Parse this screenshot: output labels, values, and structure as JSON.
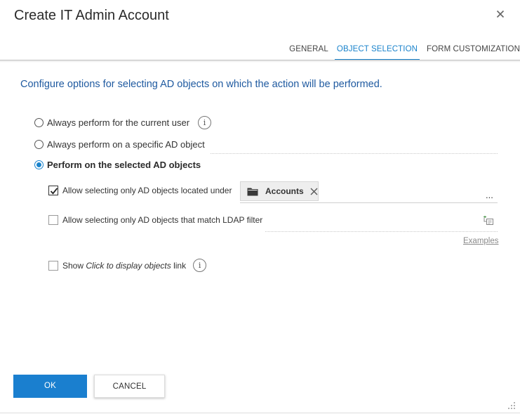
{
  "dialog": {
    "title": "Create IT Admin Account",
    "close_icon": "close-icon"
  },
  "tabs": [
    {
      "label": "GENERAL",
      "active": false
    },
    {
      "label": "OBJECT SELECTION",
      "active": true
    },
    {
      "label": "FORM CUSTOMIZATION",
      "active": false
    }
  ],
  "intro": "Configure options for selecting AD objects on which the action will be performed.",
  "radios": [
    {
      "label": "Always perform for the current user",
      "checked": false,
      "info_icon": "info-icon"
    },
    {
      "label": "Always perform on a specific AD object",
      "checked": false
    },
    {
      "label": "Perform on the selected AD objects",
      "checked": true
    }
  ],
  "options": {
    "located_under": {
      "label": "Allow selecting only AD objects located under",
      "checked": true,
      "chip_label": "Accounts",
      "chip_icon": "folder-icon",
      "browse_label": "..."
    },
    "ldap_filter": {
      "label": "Allow selecting only AD objects that match LDAP filter",
      "checked": false,
      "filter_value": "",
      "builder_icon": "filter-builder-icon",
      "examples_label": "Examples"
    },
    "show_link": {
      "label_prefix": "Show ",
      "label_italic": "Click to display objects",
      "label_suffix": " link",
      "checked": false,
      "info_icon": "info-icon"
    }
  },
  "buttons": {
    "ok": "OK",
    "cancel": "CANCEL"
  },
  "colors": {
    "accent": "#1a83cc",
    "intro_text": "#1f5aa0",
    "ok_button": "#1a7fcf"
  }
}
